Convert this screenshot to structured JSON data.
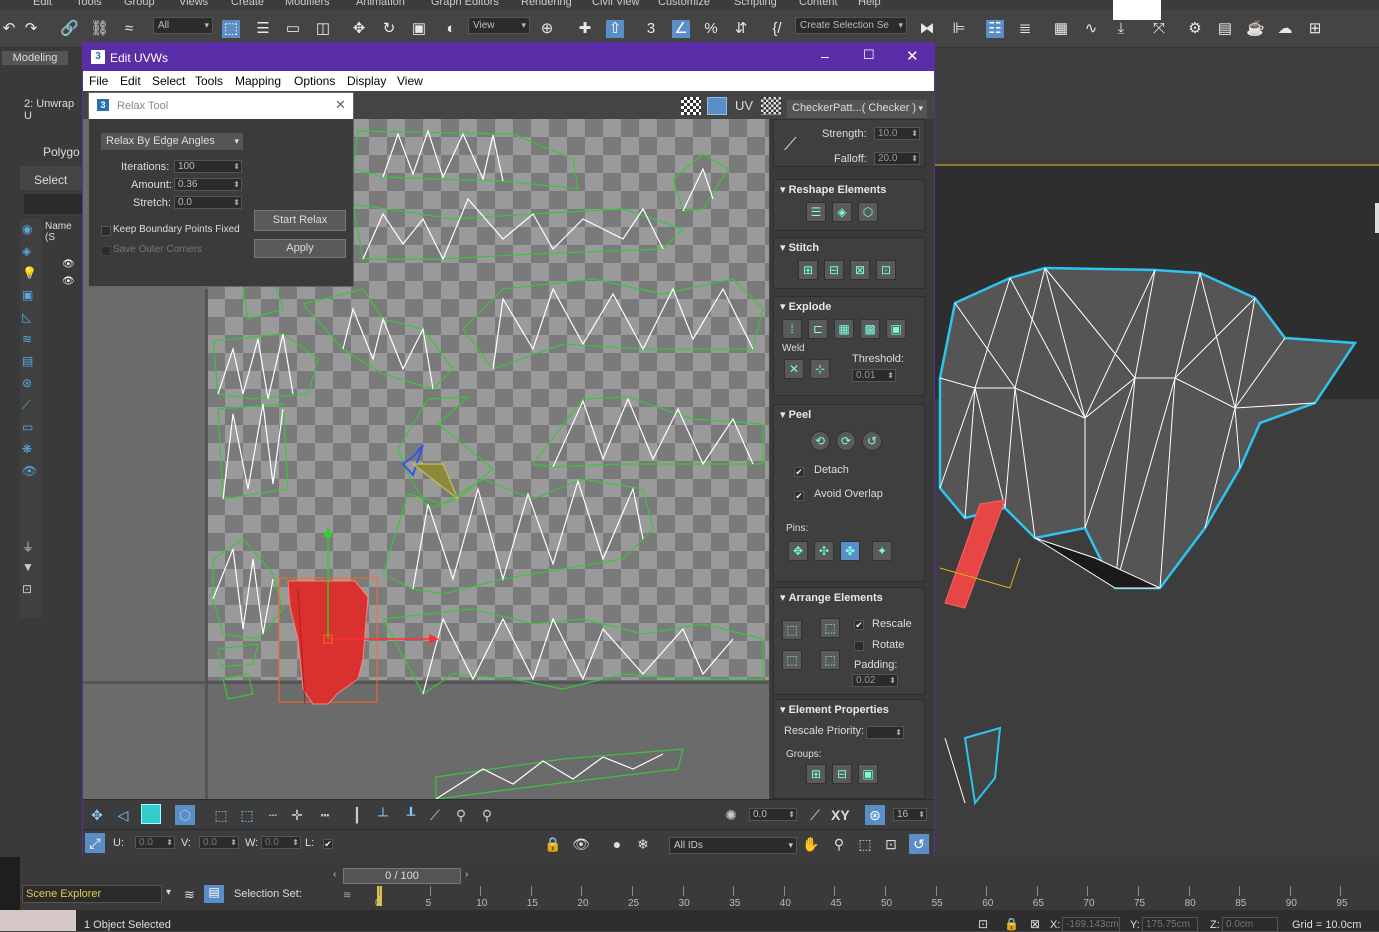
{
  "app_menu": [
    "Edit",
    "Tools",
    "Group",
    "Views",
    "Create",
    "Modifiers",
    "Animation",
    "Graph Editors",
    "Rendering",
    "Civil View",
    "Customize",
    "Scripting",
    "Content",
    "Help"
  ],
  "toolbar": {
    "filter_select": "All",
    "view_select": "View",
    "selection_set": "Create Selection Se"
  },
  "left_panel": {
    "workspace_tab": "Modeling",
    "modifier_label": "2: Unwrap U",
    "polygon_label": "Polygo",
    "select_tab": "Select",
    "name_header": "Name (S"
  },
  "uv_window": {
    "title": "Edit UVWs",
    "menus": [
      "File",
      "Edit",
      "Select",
      "Tools",
      "Mapping",
      "Options",
      "Display",
      "View"
    ],
    "uv_label": "UV",
    "checker_select": "CheckerPatt...( Checker )"
  },
  "relax_dialog": {
    "title": "Relax Tool",
    "method": "Relax By Edge Angles",
    "iterations_label": "Iterations:",
    "iterations_value": "100",
    "amount_label": "Amount:",
    "amount_value": "0.36",
    "stretch_label": "Stretch:",
    "stretch_value": "0.0",
    "keep_boundary": "Keep Boundary Points Fixed",
    "save_corners": "Save Outer Corners",
    "start_button": "Start Relax",
    "apply_button": "Apply"
  },
  "right_panel": {
    "strength_label": "Strength:",
    "strength_value": "10.0",
    "falloff_label": "Falloff:",
    "falloff_value": "20.0",
    "reshape_title": "Reshape Elements",
    "stitch_title": "Stitch",
    "explode_title": "Explode",
    "weld_label": "Weld",
    "threshold_label": "Threshold:",
    "threshold_value": "0.01",
    "peel_title": "Peel",
    "detach_label": "Detach",
    "avoid_overlap_label": "Avoid Overlap",
    "pins_label": "Pins:",
    "arrange_title": "Arrange Elements",
    "rescale_label": "Rescale",
    "rotate_label": "Rotate",
    "padding_label": "Padding:",
    "padding_value": "0.02",
    "element_props_title": "Element Properties",
    "rescale_priority_label": "Rescale Priority:",
    "groups_label": "Groups:"
  },
  "uv_bottom": {
    "spin_value": "0.0",
    "xy_label": "XY",
    "grid_value": "16",
    "u_label": "U:",
    "u_value": "0.0",
    "v_label": "V:",
    "v_value": "0.0",
    "w_label": "W:",
    "w_value": "0.0",
    "l_label": "L:",
    "ids_select": "All IDs"
  },
  "bottom": {
    "scene_explorer": "Scene Explorer",
    "selection_set_label": "Selection Set:",
    "frame_counter": "0 / 100",
    "ruler_ticks": [
      "0",
      "5",
      "10",
      "15",
      "20",
      "25",
      "30",
      "35",
      "40",
      "45",
      "50",
      "55",
      "60",
      "65",
      "70",
      "75",
      "80",
      "85",
      "90",
      "95"
    ],
    "status_text": "1 Object Selected",
    "x_label": "X:",
    "x_value": "-169.143cm",
    "y_label": "Y:",
    "y_value": "175.75cm",
    "z_label": "Z:",
    "z_value": "0.0cm",
    "grid_text": "Grid = 10.0cm"
  },
  "colors": {
    "uv_title_bg": "#5a2ea6",
    "selection_red": "#e03030",
    "uv_green": "#3cc43c",
    "mesh_blue": "#2ec4f0"
  }
}
